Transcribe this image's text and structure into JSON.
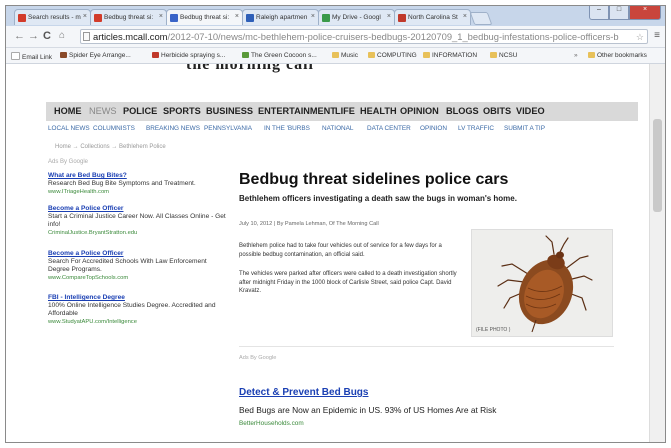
{
  "browser": {
    "tabs": [
      {
        "label": "Search results - m",
        "color": "#d23b2a"
      },
      {
        "label": "Bedbug threat si:",
        "color": "#d23b2a"
      },
      {
        "label": "Bedbug threat si:",
        "color": "#3a64c8"
      },
      {
        "label": "Raleigh apartmen",
        "color": "#2e5fb8"
      },
      {
        "label": "My Drive - Googl",
        "color": "#3a9a4a"
      },
      {
        "label": "North Carolina St",
        "color": "#c0392b"
      }
    ],
    "url_domain": "articles.mcall.com",
    "url_path": "/2012-07-10/news/mc-bethlehem-police-cruisers-bedbugs-20120709_1_bedbug-infestations-police-officers-b",
    "bookmarks": [
      {
        "label": "Email Link"
      },
      {
        "label": "Spider Eye Arrange..."
      },
      {
        "label": "Herbicide spraying s..."
      },
      {
        "label": "The Green Cocoon s..."
      },
      {
        "label": "Music"
      },
      {
        "label": "COMPUTING"
      },
      {
        "label": "INFORMATION"
      },
      {
        "label": "NCSU"
      },
      {
        "label": "Other bookmarks"
      }
    ]
  },
  "site": {
    "nav": [
      "HOME",
      "NEWS",
      "POLICE",
      "SPORTS",
      "BUSINESS",
      "ENTERTAINMENT",
      "LIFE",
      "HEALTH",
      "OPINION",
      "BLOGS",
      "OBITS",
      "VIDEO"
    ],
    "subnav": [
      "LOCAL NEWS",
      "COLUMNISTS",
      "BREAKING NEWS",
      "PENNSYLVANIA",
      "IN THE 'BURBS",
      "NATIONAL",
      "DATA CENTER",
      "OPINION",
      "LV TRAFFIC",
      "SUBMIT A TIP"
    ],
    "breadcrumb": "Home → Collections → Bethlehem Police"
  },
  "sidebar": {
    "ads_by": "Ads By Google",
    "ads": [
      {
        "title": "What are Bed Bug Bites?",
        "desc": "Research Bed Bug Bite Symptoms and Treatment.",
        "url": "www.ITriageHealth.com"
      },
      {
        "title": "Become a Police Officer",
        "desc": "Start a Criminal Justice Career Now. All Classes Online - Get info!",
        "url": "CriminalJustice.BryantStratton.edu"
      },
      {
        "title": "Become a Police Officer",
        "desc": "Search For Accredited Schools With Law Enforcement Degree Programs.",
        "url": "www.CompareTopSchools.com"
      },
      {
        "title": "FBI - Intelligence Degree",
        "desc": "100% Online Intelligence Studies Degree. Accredited and Affordable",
        "url": "www.StudyatAPU.com/Intelligence"
      }
    ]
  },
  "article": {
    "headline": "Bedbug threat sidelines police cars",
    "subhead": "Bethlehem officers investigating a death saw the bugs in woman's home.",
    "byline": "July 10, 2012 | By Pamela Lehman, Of The Morning Call",
    "paragraphs": [
      "Bethlehem police had to take four vehicles out of service for a few days for a possible bedbug contamination, an official said.",
      "The vehicles were parked after officers were called to a death investigation shortly after midnight Friday in the 1000 block of Carlisle Street, said police Capt. David Kravatz."
    ],
    "photo_caption": "(FILE PHOTO )"
  },
  "bottom_ad": {
    "ads_by": "Ads By Google",
    "title": "Detect & Prevent Bed Bugs",
    "desc": "Bed Bugs are Now an Epidemic in US. 93% of US Homes Are at Risk",
    "url": "BetterHouseholds.com"
  }
}
